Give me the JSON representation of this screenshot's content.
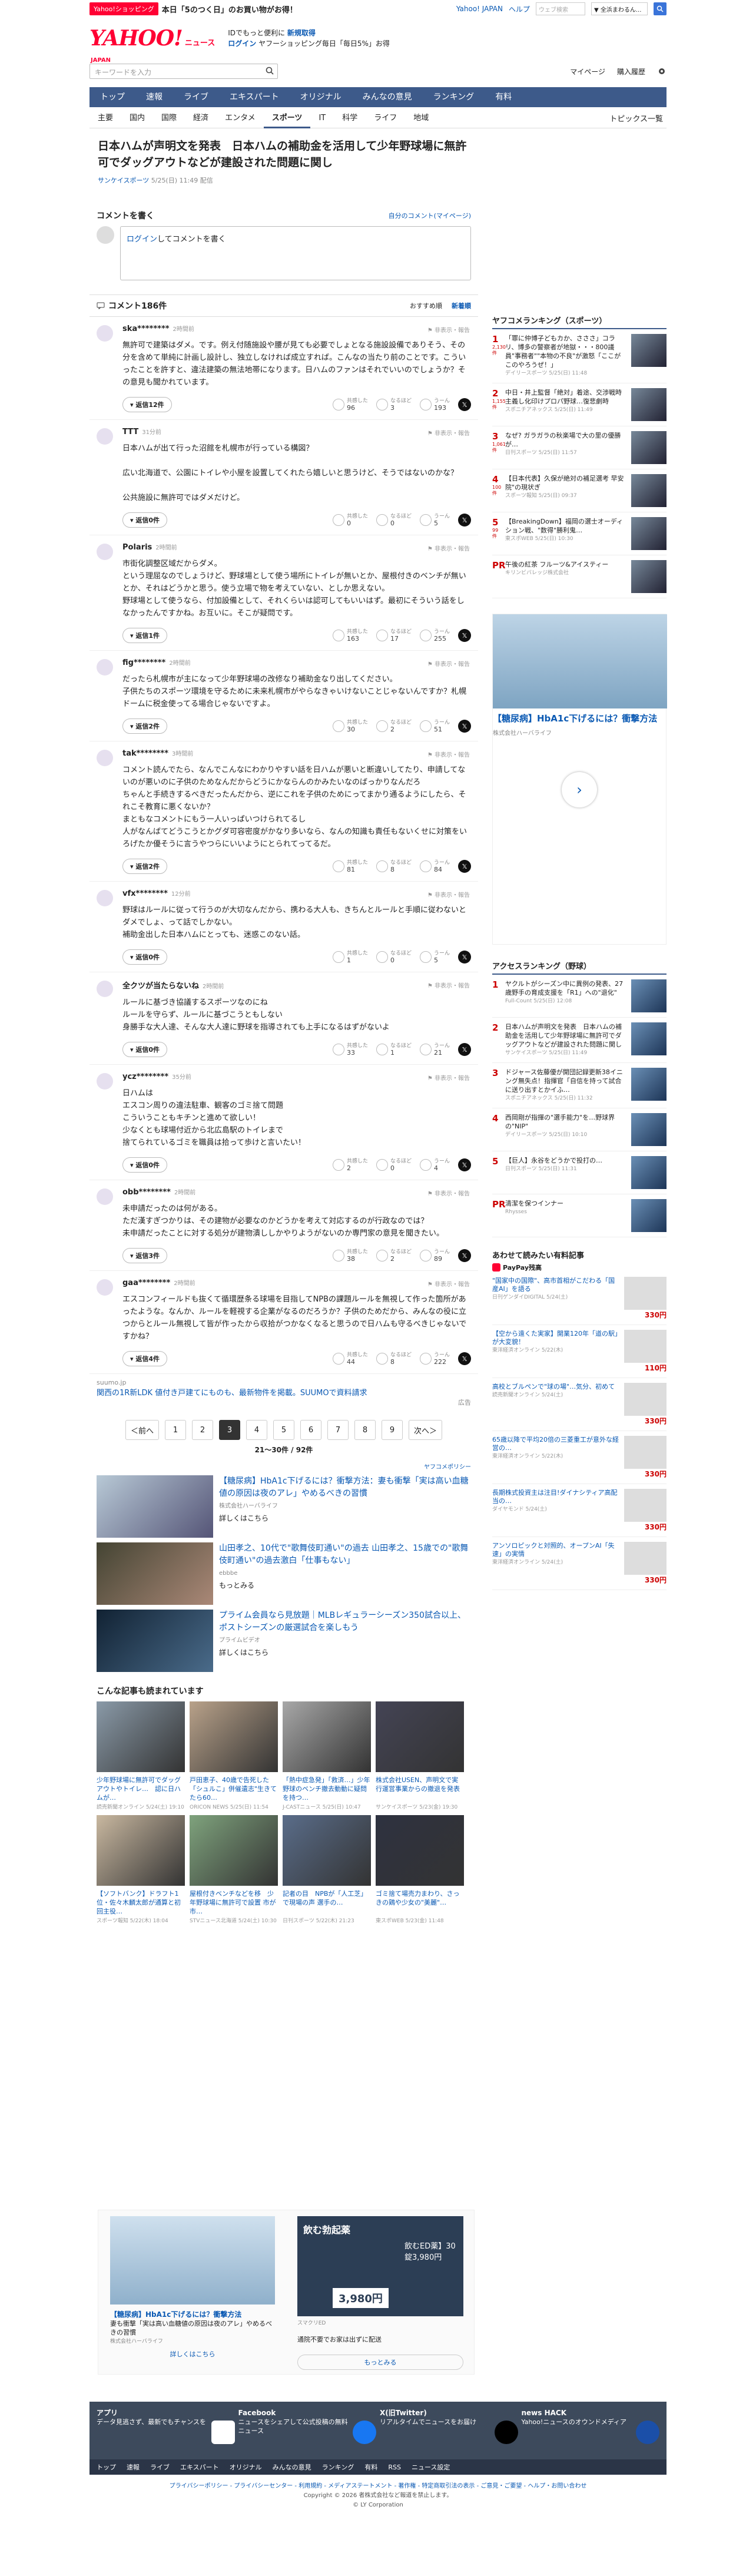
{
  "topbar": {
    "shop_badge": "Yahoo!ショッピング",
    "promo": "本日「5のつく日」のお買い物がお得！",
    "yahoo_japan": "Yahoo! JAPAN",
    "help": "ヘルプ",
    "search_placeholder": "ウェブ検索",
    "search_all": "▼ 全浜まわるん..."
  },
  "header": {
    "logo": "YAHOO!",
    "logo_japan": "JAPAN",
    "logo_news": "ニュース",
    "line1": "IDでもっと便利に",
    "line1_link": "新規取得",
    "login": "ログイン",
    "line2": "ヤフーショッピング毎日「毎日5%」お得"
  },
  "search": {
    "placeholder": "キーワードを入力",
    "mypage": "マイページ",
    "history": "購入履歴"
  },
  "nav": {
    "items": [
      "トップ",
      "速報",
      "ライブ",
      "エキスパート",
      "オリジナル",
      "みんなの意見",
      "ランキング",
      "有料"
    ],
    "sub": [
      "主要",
      "国内",
      "国際",
      "経済",
      "エンタメ",
      "スポーツ",
      "IT",
      "科学",
      "ライフ",
      "地域"
    ],
    "topics_list": "トピックス一覧"
  },
  "article": {
    "title": "日本ハムが声明文を発表　日本ハムの補助金を活用して少年野球場に無許可でダッグアウトなどが建設された問題に関し",
    "source": "サンケイスポーツ",
    "date": "5/25(日) 11:49 配信"
  },
  "comment_form": {
    "heading": "コメントを書く",
    "mine": "自分のコメント(マイページ)",
    "login": "ログイン",
    "prompt": "してコメントを書く"
  },
  "comments_head": {
    "title": "コメント186件",
    "sort1": "おすすめ順",
    "sort2": "新着順"
  },
  "comments": [
    {
      "user": "ska********",
      "time": "2時間前",
      "body": "無許可で建築はダメ。です。例え付随施設や腰が見ても必要でしょとなる施設設備でありそう、その分を含めて単純に計画し設計し、独立しなければ成立すれば。こんなの当たり前のことです。こういったことを許すと、違法建築の無法地帯になります。日ハムのファンはそれでいいのでしょうか？その意見も聞かれています。",
      "reply": "返信12件",
      "r1": "96",
      "r2": "3",
      "r3": "193"
    },
    {
      "user": "TTT",
      "time": "31分前",
      "body": "日本ハムが出て行った沼館を札幌市が行っている構図？\n\n広い北海道で、公園にトイレや小屋を設置してくれたら嬉しいと思うけど、そうではないのかな？\n\n公共施設に無許可ではダメだけど。",
      "reply": "返信0件",
      "r1": "0",
      "r2": "0",
      "r3": "5"
    },
    {
      "user": "Polaris",
      "time": "2時間前",
      "body": "市街化調整区域だからダメ。\nという理屈なのでしょうけど、野球場として使う場所にトイレが無いとか、屋根付きのベンチが無いとか、それはどうかと思う。使う立場で物を考えていない、としか思えない。\n野球場として使うなら、付加設備として、それくらいは認可してもいいはず。最初にそういう話をしなかったんですかね。お互いに。そこが疑問です。",
      "reply": "返信1件",
      "r1": "163",
      "r2": "17",
      "r3": "255"
    },
    {
      "user": "fig********",
      "time": "2時間前",
      "body": "だったら札幌市が主になって少年野球場の改修なり補助金なり出してください。\n子供たちのスポーツ環境を守るために未来札幌市がやらなきゃいけないことじゃないんですか？札幌ドームに税金使ってる場合じゃないですよ。",
      "reply": "返信2件",
      "r1": "30",
      "r2": "2",
      "r3": "51"
    },
    {
      "user": "tak********",
      "time": "3時間前",
      "body": "コメント読んでたら、なんでこんなにわかりやすい話を日ハムが悪いと断違いしてたり、申請してないのが悪いのに子供のためなんだからどうにかならんのかみたいなのばっかりなんだろ\nちゃんと手続きするべきだったんだから、逆にこれを子供のためにってまかり通るようにしたら、それこそ教育に悪くないか？\nまともなコメントにもう一人いっぱいつけられてるし\n人がなんばてどうこうとかグダ可容密度がかなり多いなら、なんの知識も責任もないくせに対策をいろげたか優そうに言うやつらにいいようにとられてってるだ。",
      "reply": "返信2件",
      "r1": "81",
      "r2": "8",
      "r3": "84"
    },
    {
      "user": "vfx********",
      "time": "12分前",
      "body": "野球はルールに従って行うのが大切なんだから、携わる大人も、きちんとルールと手順に従わないとダメでしょ、って話でしかない。\n補助金出した日本ハムにとっても、迷惑このない話。",
      "reply": "返信0件",
      "r1": "1",
      "r2": "0",
      "r3": "5"
    },
    {
      "user": "全クツが当たらないね",
      "time": "2時間前",
      "body": "ルールに基づき協議するスポーツなのにね\nルールを守らず、ルールに基づこうともしない\n身勝手な大人達、そんな大人達に野球を指導されても上手になるはずがないよ",
      "reply": "返信0件",
      "r1": "33",
      "r2": "1",
      "r3": "21"
    },
    {
      "user": "ycz********",
      "time": "35分前",
      "body": "日ハムは\nエスコン周りの違法駐車、観客のゴミ捨て問題\nこういうこともキチンと進めて欲しい！\n少なくとも球場付近から北広島駅のトイレまで\n捨てられているゴミを職員は拾って歩けと言いたい！",
      "reply": "返信0件",
      "r1": "2",
      "r2": "0",
      "r3": "4"
    },
    {
      "user": "obb********",
      "time": "2時間前",
      "body": "未申請だったのは何がある。\nただ漢すぎつかりは、その建物が必要なのかどうかを考えて対応するのが行政なのでは？\n未申請だったことに対する処分が建物潰ししかやりようがないのか専門家の意見を聞きたい。",
      "reply": "返信3件",
      "r1": "38",
      "r2": "2",
      "r3": "89"
    },
    {
      "user": "gaa********",
      "time": "2時間前",
      "body": "エスコンフィールドも抜くて循環歴条る球場を目指してNPBの課題ルールを無視して作った箇所があったような。なんか、ルールを軽視する企業がなるのだろうか？子供のためだから、みんなの役に立つからとルール無視して皆が作ったから収拾がつかなくなると思うので日ハムも守るべきじゃないですかね？",
      "reply": "返信4件",
      "r1": "44",
      "r2": "8",
      "r3": "222"
    }
  ],
  "sumo": {
    "label": "suumo.jp",
    "title": "関西の1R新LDK 値付き戸建てにものも、最新物件を掲載。SUUMOで資料請求",
    "ad": "広告"
  },
  "pager": {
    "prev": "＜前へ",
    "pages": [
      "1",
      "2",
      "3",
      "4",
      "5",
      "6",
      "7",
      "8",
      "9"
    ],
    "current": "3",
    "next": "次へ＞",
    "info": "21〜30件 / 92件",
    "policy": "ヤフコメポリシー"
  },
  "ads_main": [
    {
      "title": "【糖尿病】HbA1c下げるには？衝撃方法：妻も衝撃「実は高い血糖値の原因は夜のアレ」やめるべきの習慣",
      "by": "株式会社ハーバライフ",
      "more": "詳しくはこちら"
    },
    {
      "title": "山田孝之、10代で\"歌舞伎町通い\"の過去 山田孝之、15歳での\"歌舞伎町通い\"の過去激白「仕事もない」",
      "by": "ebbbe",
      "more": "もっとみる"
    },
    {
      "title": "プライム会員なら見放題｜MLBレギュラーシーズン350試合以上、ポストシーズンの厳選試合を楽しもう",
      "by": "プライムビデオ",
      "more": "詳しくはこちら"
    }
  ],
  "also_read": {
    "heading": "こんな記事も読まれています",
    "items": [
      {
        "t": "少年野球場に無許可でダッグアウトやトイレ…　認に日ハムが…",
        "d": "読売新聞オンライン 5/24(土) 19:10"
      },
      {
        "t": "戸田恵子、40歳で告死した「シュルこ」併催遺志\"生きてたら60…",
        "d": "ORICON NEWS 5/25(日) 11:54"
      },
      {
        "t": "「熱中症急発」「救済…」少年野球のベンチ撤去動動に疑問を持つ…",
        "d": "J-CASTニュース 5/25(日) 10:47"
      },
      {
        "t": "株式会社USEN、声明文で実行運営事業からの撤退を発表",
        "d": "サンケイスポーツ 5/23(金) 19:30"
      },
      {
        "t": "【ソフトバンク】ドラフト1位・佐々木麟太郎が通算と初回主役…",
        "d": "スポーツ報知 5/22(木) 18:04"
      },
      {
        "t": "屋根付きベンチなどを移　少年野球場に無許可で設置 市が市…",
        "d": "STVニュース北海道 5/24(土) 10:30"
      },
      {
        "t": "記者の目　NPBが「人工芝」で現場の声 選手の…",
        "d": "日刊スポーツ 5/22(木) 21:23"
      },
      {
        "t": "ゴミ捨て場売力まわり、さっきの鶏や少女の\"美麗\"…",
        "d": "東スポWEB 5/23(金) 11:48"
      }
    ]
  },
  "bottom_ad": {
    "l_title": "【糖尿病】HbA1c下げるには？衝撃方法",
    "l_body": "妻も衝撃「実は高い血糖値の原因は夜のアレ」やめるべきの習慣",
    "l_by": "株式会社ハーバライフ",
    "l_more": "詳しくはこちら",
    "r_title": "飲む勃起薬",
    "r_sub": "飲むED薬】30錠3,980円",
    "r_price": "3,980円",
    "r_by": "スマクリED",
    "r_note": "通院不要でお家は出ずに配送",
    "r_more": "もっとみる"
  },
  "side": {
    "rank_head": "ヤフコメランキング（スポーツ）",
    "ranks": [
      {
        "n": "1",
        "t": "「罪に仲博子どもカか、さささ」コラリ、博多の警察者が地獄・・・800議員\"事務者\"\"本物の不良\"が激怒「ここがこのやろうぜ！」",
        "s": "デイリースポーツ 5/25(日) 11:48",
        "x": "2,130件"
      },
      {
        "n": "2",
        "t": "中日・井上監督「絶対」着途、交渉戦時主義し化印けプロパ野球…復悲劇時",
        "s": "スポニチアネックス 5/25(日) 11:49",
        "x": "1,155件"
      },
      {
        "n": "3",
        "t": "なぜ? ガラガラの秋楽場で大の里の優勝が…",
        "s": "日刊スポーツ 5/25(日) 11:57",
        "x": "1,061件"
      },
      {
        "n": "4",
        "t": "【日本代表】久保が絶対の補足選考 早安院\"の現状ぎ",
        "s": "スポーツ報知 5/25(日) 09:37",
        "x": "100件"
      },
      {
        "n": "5",
        "t": "【BreakingDown】福岡の選士オーディション戦、\"数得\"勝利鬼…",
        "s": "東スポWEB 5/25(日) 10:30",
        "x": "99件"
      },
      {
        "n": "PR",
        "t": "午後の紅茶 フルーツ&アイスティー",
        "s": "キリンビバレッジ株式会社",
        "x": ""
      }
    ],
    "ad_title": "【糖尿病】HbA1c下げるには？衝撃方法",
    "ad_by": "株式会社ハーバライフ",
    "access_head": "アクセスランキング（野球）",
    "access": [
      {
        "n": "1",
        "t": "ヤクルトがシーズン中に異例の発表、27歳野手の育成支援を「R1」への\"退化\"",
        "s": "Full-Count 5/25(日) 12:08"
      },
      {
        "n": "2",
        "t": "日本ハムが声明文を発表　日本ハムの補助金を活用して少年野球場に無許可でダッグアウトなどが建設された問題に関し",
        "s": "サンケイスポーツ 5/25(日) 11:49"
      },
      {
        "n": "3",
        "t": "ドジャース佐藤優が開団記録更新38イニング無失点！指揮官「自信を持って試合に送り出すとかイふ…",
        "s": "スポニチアネックス 5/25(日) 11:32"
      },
      {
        "n": "4",
        "t": "西岡剛が指揮の\"選手能力\"を…野球界の\"NIP\"",
        "s": "デイリースポーツ 5/25(日) 10:10"
      },
      {
        "n": "5",
        "t": "【巨人】永谷をどうかで投打の…",
        "s": "日刊スポーツ 5/25(日) 11:31"
      },
      {
        "n": "PR",
        "t": "清潔を保つインナー",
        "s": "Rhysses",
        "x": ""
      }
    ],
    "osusume_head": "あわせて読みたい有料記事",
    "paypay": "PayPay残高",
    "prods": [
      {
        "t": "\"国家中の国際\"、高市首相がこだわる「国産AI」を語る",
        "s": "日刊ゲンダイDIGITAL 5/24(土)",
        "p": "330円"
      },
      {
        "t": "【空から遠くた実家】開業120年「道の駅」が大変貌！",
        "s": "東洋経済オンライン 5/22(木)",
        "p": "110円"
      },
      {
        "t": "高校とブルペンで\"球の場\"…気分、初めて",
        "s": "読売新聞オンライン 5/24(土)",
        "p": "330円"
      },
      {
        "t": "65歳以降で平均20倍の三菱重工が意外な経営の…",
        "s": "東洋経済オンライン 5/22(木)",
        "p": "330円"
      },
      {
        "t": "長期株式投資主は注目!ダイナシティア高配当の…",
        "s": "ダイヤモンド 5/24(土)",
        "p": "330円"
      },
      {
        "t": "アンソロピックと対照的、オープンAI「失速」の実情",
        "s": "東洋経済オンライン 5/24(土)",
        "p": "330円"
      }
    ]
  },
  "footer": {
    "apps": [
      {
        "name": "アプリ",
        "desc": "データ見逃さず、最新でもチャンスを"
      },
      {
        "name": "Facebook",
        "desc": "ニュースをシェアして公式投稿の無料ニュース"
      },
      {
        "name": "X(旧Twitter)",
        "desc": "リアルタイムでニュースをお届け"
      },
      {
        "name": "news HACK",
        "desc": "Yahoo!ニュースのオウンドメディア"
      }
    ],
    "nav": [
      "トップ",
      "速報",
      "ライブ",
      "エキスパート",
      "オリジナル",
      "みんなの意見",
      "ランキング",
      "有料",
      "RSS",
      "ニュース設定"
    ],
    "links": "プライバシーポリシー - プライバシーセンター - 利用規約 - メディアステートメント - 著作権 - 特定商取引法の表示 - ご意見・ご要望 - ヘルプ・お問い合わせ",
    "copyright1": "Copyright © 2026 者株式会社など報道を禁止します。",
    "copyright2": "© LY Corporation"
  }
}
